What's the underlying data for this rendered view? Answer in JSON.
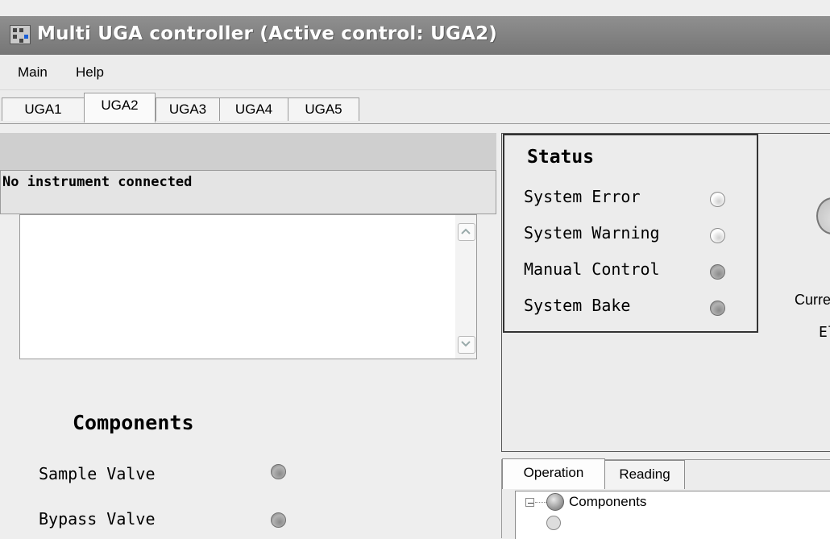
{
  "window": {
    "title": "Multi UGA controller  (Active control: UGA2)",
    "icon": "app-window-icon"
  },
  "menu": {
    "items": [
      "Main",
      "Help"
    ]
  },
  "tabs": {
    "items": [
      "UGA1",
      "UGA2",
      "UGA3",
      "UGA4",
      "UGA5"
    ],
    "active": "UGA2"
  },
  "left": {
    "message": "No instrument connected",
    "components": {
      "title": "Components",
      "items": [
        {
          "label": "Sample Valve",
          "state": "grey"
        },
        {
          "label": "Bypass Valve",
          "state": "grey"
        }
      ]
    }
  },
  "status": {
    "title": "Status",
    "items": [
      {
        "label": "System Error",
        "state": "white"
      },
      {
        "label": "System Warning",
        "state": "white"
      },
      {
        "label": "Manual Control",
        "state": "grey"
      },
      {
        "label": "System Bake",
        "state": "grey"
      }
    ]
  },
  "right": {
    "current_label": "Curre",
    "el_label": "El"
  },
  "bottom": {
    "tabs": [
      "Operation",
      "Reading"
    ],
    "active": "Operation",
    "tree_root": "Components"
  }
}
